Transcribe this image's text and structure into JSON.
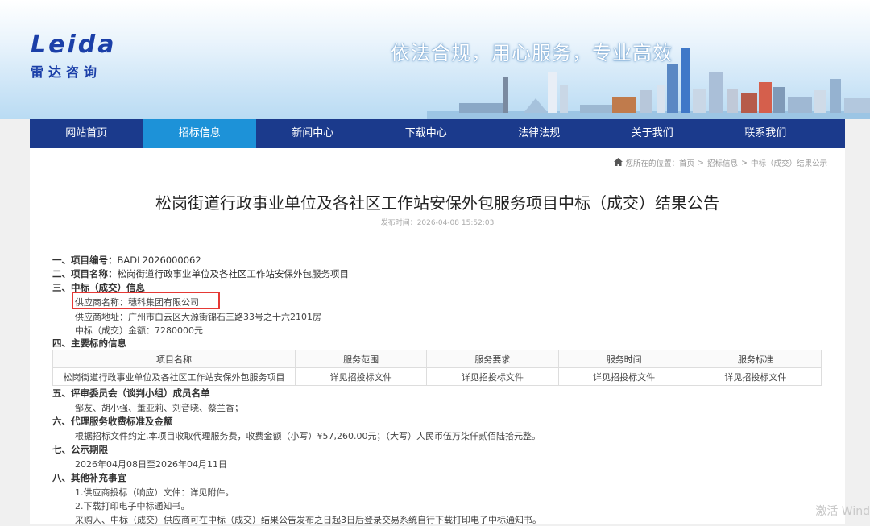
{
  "header": {
    "logo_en": "Leida",
    "logo_cn": "雷达咨询",
    "slogan": "依法合规，用心服务，专业高效"
  },
  "nav": {
    "items": [
      {
        "label": "网站首页"
      },
      {
        "label": "招标信息"
      },
      {
        "label": "新闻中心"
      },
      {
        "label": "下载中心"
      },
      {
        "label": "法律法规"
      },
      {
        "label": "关于我们"
      },
      {
        "label": "联系我们"
      }
    ],
    "active_index": 1
  },
  "breadcrumb": {
    "prefix": "您所在的位置：",
    "items": [
      "首页",
      "招标信息",
      "中标（成交）结果公示"
    ],
    "separator": ">"
  },
  "article": {
    "title": "松岗街道行政事业单位及各社区工作站安保外包服务项目中标（成交）结果公告",
    "publish_time": "发布时间：2026-04-08 15:52:03",
    "sections": {
      "s1_label": "一、项目编号：",
      "s1_value": "BADL2026000062",
      "s2_label": "二、项目名称：",
      "s2_value": "松岗街道行政事业单位及各社区工作站安保外包服务项目",
      "s3_label": "三、中标（成交）信息",
      "supplier_name": "供应商名称：穗科集团有限公司",
      "supplier_address": "供应商地址：广州市白云区大源街锦石三路33号之十六2101房",
      "bid_amount": "中标（成交）金额：7280000元",
      "s4_label": "四、主要标的信息",
      "s5_label": "五、评审委员会（谈判小组）成员名单",
      "members": "邹友、胡小强、董亚莉、刘音晓、蔡兰香；",
      "s6_label": "六、代理服务收费标准及金额",
      "fee_text": "根据招标文件约定,本项目收取代理服务费，收费金额（小写）¥57,260.00元；（大写）人民币伍万柒仟贰佰陆拾元整。",
      "s7_label": "七、公示期限",
      "period": "2026年04月08日至2026年04月11日",
      "s8_label": "八、其他补充事宜",
      "other1": "1.供应商投标（响应）文件：详见附件。",
      "other2": "2.下载打印电子中标通知书。",
      "other3": "采购人、中标（成交）供应商可在中标（成交）结果公告发布之日起3日后登录交易系统自行下载打印电子中标通知书。"
    }
  },
  "lots_table": {
    "headers": [
      "项目名称",
      "服务范围",
      "服务要求",
      "服务时间",
      "服务标准"
    ],
    "rows": [
      [
        "松岗街道行政事业单位及各社区工作站安保外包服务项目",
        "详见招投标文件",
        "详见招投标文件",
        "详见招投标文件",
        "详见招投标文件"
      ]
    ]
  },
  "watermark": "激活 Wind",
  "colors": {
    "nav_bg": "#1b3a8c",
    "nav_active": "#1d92d8",
    "highlight_border": "#e53935",
    "logo": "#1b3fa8"
  }
}
